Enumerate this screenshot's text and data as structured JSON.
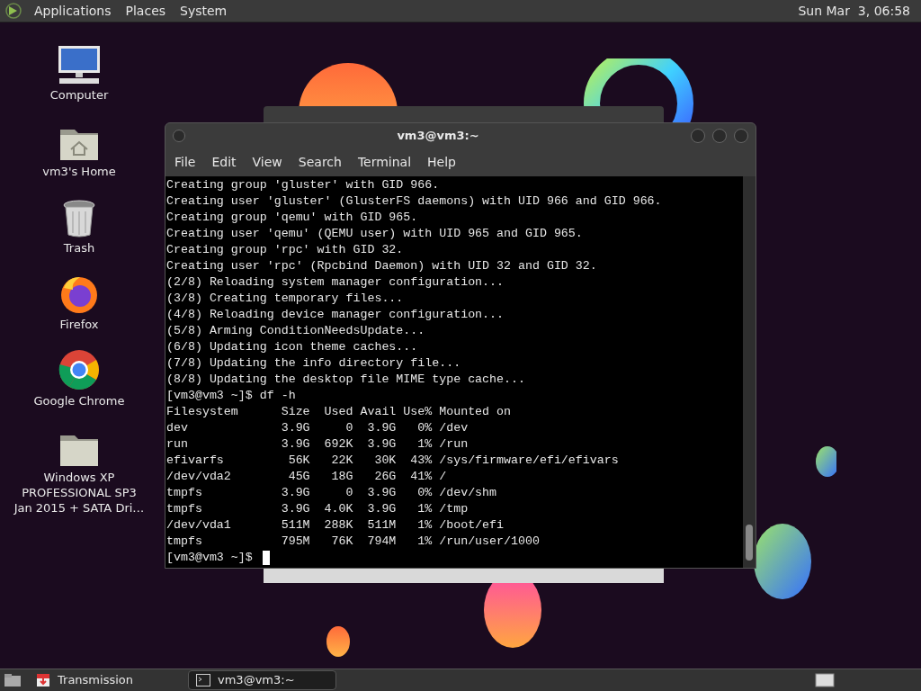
{
  "top_panel": {
    "menus": [
      "Applications",
      "Places",
      "System"
    ],
    "clock": "Sun Mar  3, 06:58"
  },
  "desktop_icons": [
    {
      "kind": "computer",
      "label": "Computer"
    },
    {
      "kind": "home",
      "label": "vm3's Home"
    },
    {
      "kind": "trash",
      "label": "Trash"
    },
    {
      "kind": "firefox",
      "label": "Firefox"
    },
    {
      "kind": "chrome",
      "label": "Google Chrome"
    },
    {
      "kind": "folder",
      "label": "Windows XP PROFESSIONAL SP3 Jan 2015 + SATA Dri…"
    }
  ],
  "terminal": {
    "title": "vm3@vm3:~",
    "menu": [
      "File",
      "Edit",
      "View",
      "Search",
      "Terminal",
      "Help"
    ],
    "lines": [
      "Creating group 'gluster' with GID 966.",
      "Creating user 'gluster' (GlusterFS daemons) with UID 966 and GID 966.",
      "Creating group 'qemu' with GID 965.",
      "Creating user 'qemu' (QEMU user) with UID 965 and GID 965.",
      "Creating group 'rpc' with GID 32.",
      "Creating user 'rpc' (Rpcbind Daemon) with UID 32 and GID 32.",
      "(2/8) Reloading system manager configuration...",
      "(3/8) Creating temporary files...",
      "(4/8) Reloading device manager configuration...",
      "(5/8) Arming ConditionNeedsUpdate...",
      "(6/8) Updating icon theme caches...",
      "(7/8) Updating the info directory file...",
      "(8/8) Updating the desktop file MIME type cache...",
      "[vm3@vm3 ~]$ df -h",
      "Filesystem      Size  Used Avail Use% Mounted on",
      "dev             3.9G     0  3.9G   0% /dev",
      "run             3.9G  692K  3.9G   1% /run",
      "efivarfs         56K   22K   30K  43% /sys/firmware/efi/efivars",
      "/dev/vda2        45G   18G   26G  41% /",
      "tmpfs           3.9G     0  3.9G   0% /dev/shm",
      "tmpfs           3.9G  4.0K  3.9G   1% /tmp",
      "/dev/vda1       511M  288K  511M   1% /boot/efi",
      "tmpfs           795M   76K  794M   1% /run/user/1000"
    ],
    "prompt": "[vm3@vm3 ~]$"
  },
  "taskbar": {
    "tasks": [
      {
        "kind": "transmission",
        "label": "Transmission",
        "selected": false
      },
      {
        "kind": "terminal",
        "label": "vm3@vm3:~",
        "selected": true
      }
    ]
  }
}
